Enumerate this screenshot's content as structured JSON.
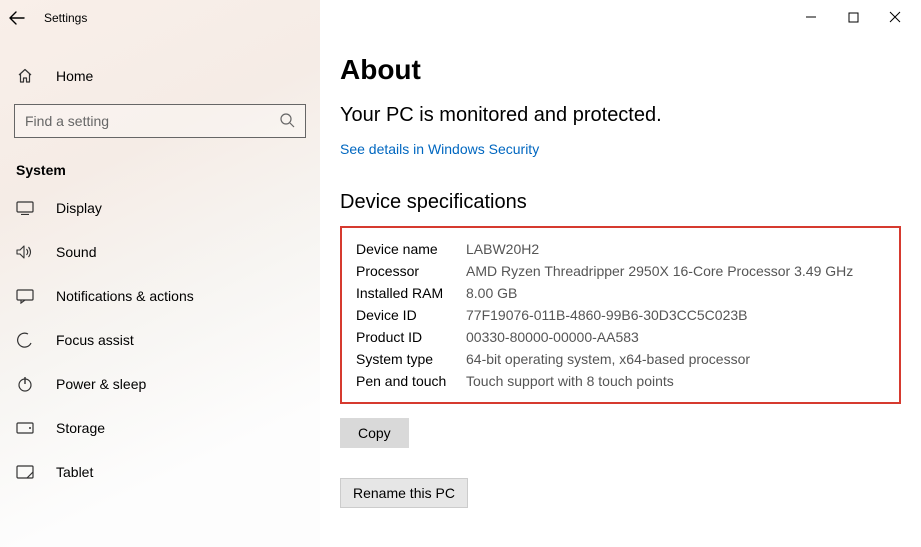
{
  "titlebar": {
    "title": "Settings"
  },
  "home": {
    "label": "Home"
  },
  "search": {
    "placeholder": "Find a setting"
  },
  "category": "System",
  "nav": [
    {
      "label": "Display"
    },
    {
      "label": "Sound"
    },
    {
      "label": "Notifications & actions"
    },
    {
      "label": "Focus assist"
    },
    {
      "label": "Power & sleep"
    },
    {
      "label": "Storage"
    },
    {
      "label": "Tablet"
    }
  ],
  "page": {
    "title": "About",
    "protection": "Your PC is monitored and protected.",
    "security_link": "See details in Windows Security",
    "specs_title": "Device specifications",
    "specs": {
      "device_name_label": "Device name",
      "device_name": "LABW20H2",
      "processor_label": "Processor",
      "processor": "AMD Ryzen Threadripper 2950X 16-Core Processor 3.49 GHz",
      "ram_label": "Installed RAM",
      "ram": "8.00 GB",
      "device_id_label": "Device ID",
      "device_id": "77F19076-011B-4860-99B6-30D3CC5C023B",
      "product_id_label": "Product ID",
      "product_id": "00330-80000-00000-AA583",
      "system_type_label": "System type",
      "system_type": "64-bit operating system, x64-based processor",
      "pen_touch_label": "Pen and touch",
      "pen_touch": "Touch support with 8 touch points"
    },
    "copy_button": "Copy",
    "rename_button": "Rename this PC"
  }
}
